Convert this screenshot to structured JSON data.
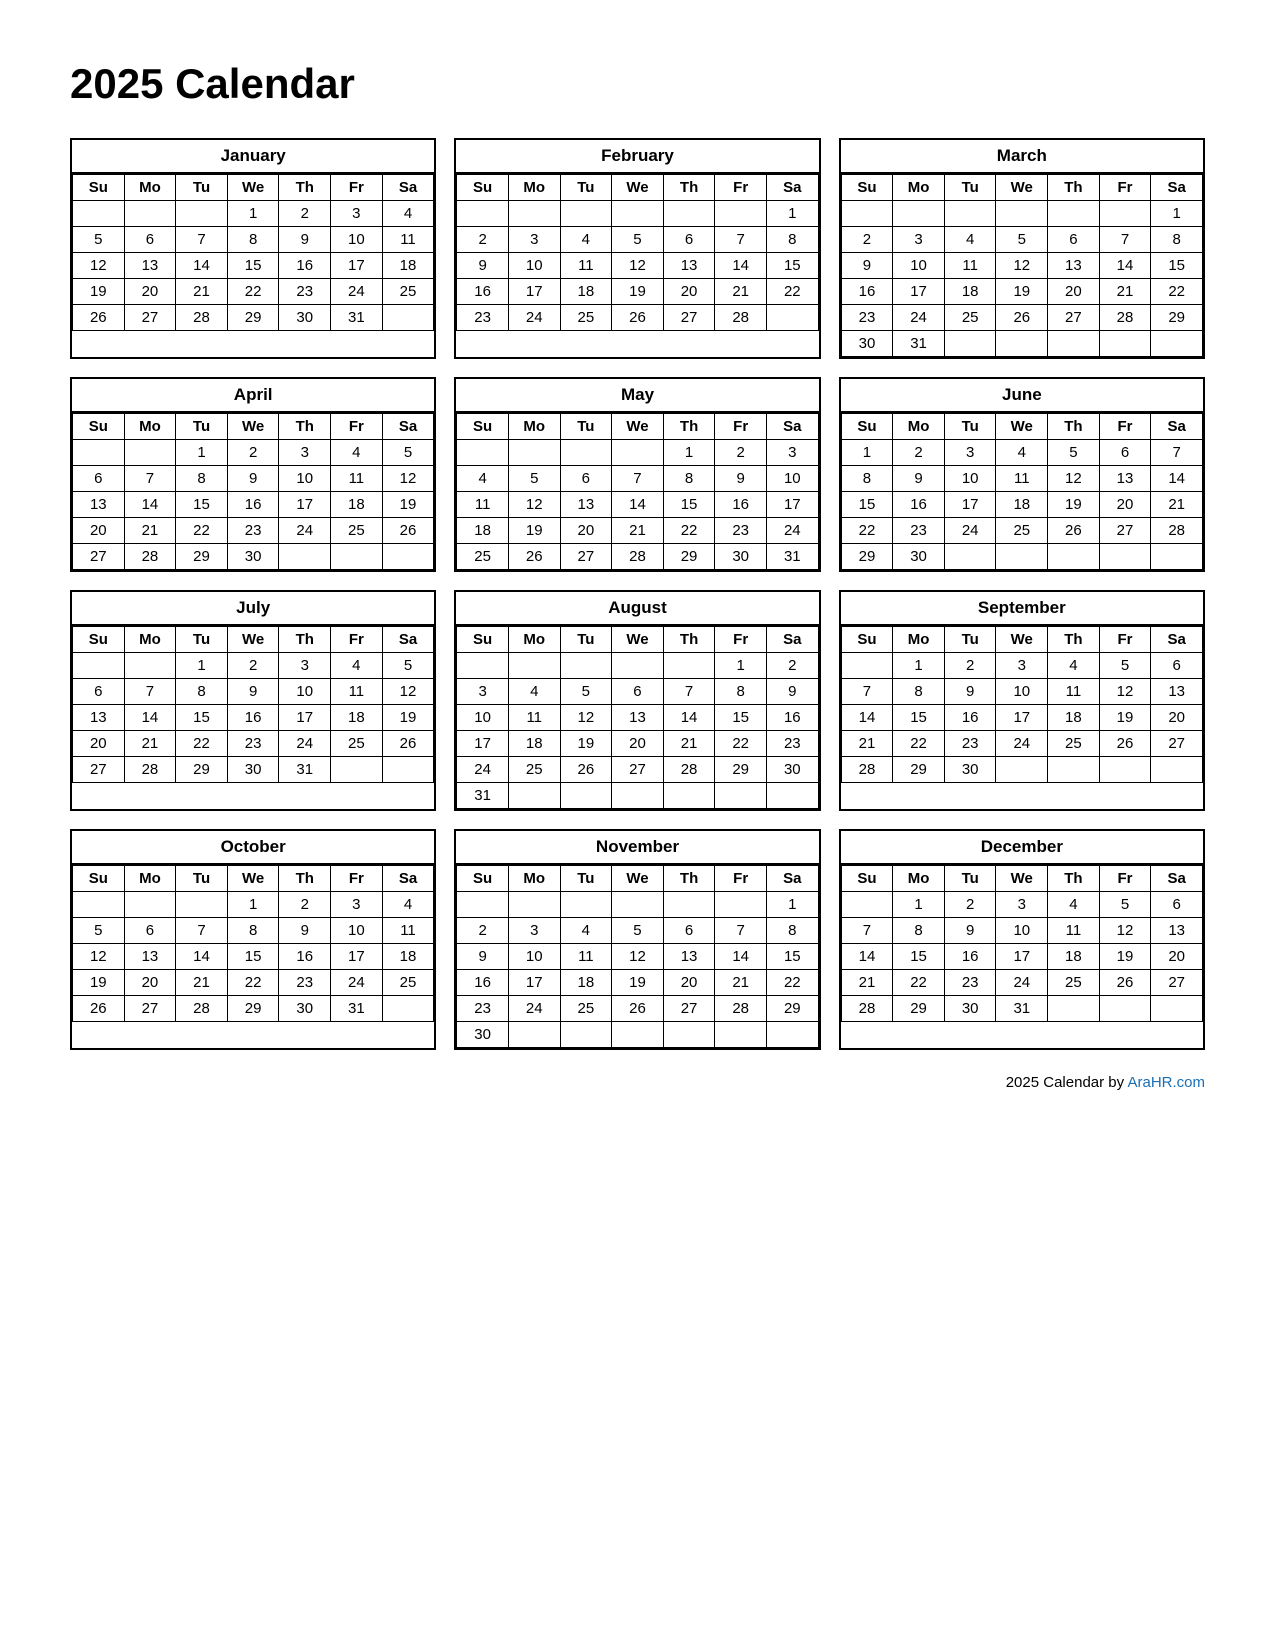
{
  "title": "2025 Calendar",
  "footer": {
    "text": "2025  Calendar by ",
    "link_label": "AraHR.com",
    "link_url": "AraHR.com"
  },
  "months": [
    {
      "name": "January",
      "days_header": [
        "Su",
        "Mo",
        "Tu",
        "We",
        "Th",
        "Fr",
        "Sa"
      ],
      "weeks": [
        [
          "",
          "",
          "",
          "1",
          "2",
          "3",
          "4"
        ],
        [
          "5",
          "6",
          "7",
          "8",
          "9",
          "10",
          "11"
        ],
        [
          "12",
          "13",
          "14",
          "15",
          "16",
          "17",
          "18"
        ],
        [
          "19",
          "20",
          "21",
          "22",
          "23",
          "24",
          "25"
        ],
        [
          "26",
          "27",
          "28",
          "29",
          "30",
          "31",
          ""
        ]
      ]
    },
    {
      "name": "February",
      "days_header": [
        "Su",
        "Mo",
        "Tu",
        "We",
        "Th",
        "Fr",
        "Sa"
      ],
      "weeks": [
        [
          "",
          "",
          "",
          "",
          "",
          "",
          "1"
        ],
        [
          "2",
          "3",
          "4",
          "5",
          "6",
          "7",
          "8"
        ],
        [
          "9",
          "10",
          "11",
          "12",
          "13",
          "14",
          "15"
        ],
        [
          "16",
          "17",
          "18",
          "19",
          "20",
          "21",
          "22"
        ],
        [
          "23",
          "24",
          "25",
          "26",
          "27",
          "28",
          ""
        ]
      ]
    },
    {
      "name": "March",
      "days_header": [
        "Su",
        "Mo",
        "Tu",
        "We",
        "Th",
        "Fr",
        "Sa"
      ],
      "weeks": [
        [
          "",
          "",
          "",
          "",
          "",
          "",
          "1"
        ],
        [
          "2",
          "3",
          "4",
          "5",
          "6",
          "7",
          "8"
        ],
        [
          "9",
          "10",
          "11",
          "12",
          "13",
          "14",
          "15"
        ],
        [
          "16",
          "17",
          "18",
          "19",
          "20",
          "21",
          "22"
        ],
        [
          "23",
          "24",
          "25",
          "26",
          "27",
          "28",
          "29"
        ],
        [
          "30",
          "31",
          "",
          "",
          "",
          "",
          ""
        ]
      ]
    },
    {
      "name": "April",
      "days_header": [
        "Su",
        "Mo",
        "Tu",
        "We",
        "Th",
        "Fr",
        "Sa"
      ],
      "weeks": [
        [
          "",
          "",
          "1",
          "2",
          "3",
          "4",
          "5"
        ],
        [
          "6",
          "7",
          "8",
          "9",
          "10",
          "11",
          "12"
        ],
        [
          "13",
          "14",
          "15",
          "16",
          "17",
          "18",
          "19"
        ],
        [
          "20",
          "21",
          "22",
          "23",
          "24",
          "25",
          "26"
        ],
        [
          "27",
          "28",
          "29",
          "30",
          "",
          "",
          ""
        ]
      ]
    },
    {
      "name": "May",
      "days_header": [
        "Su",
        "Mo",
        "Tu",
        "We",
        "Th",
        "Fr",
        "Sa"
      ],
      "weeks": [
        [
          "",
          "",
          "",
          "",
          "1",
          "2",
          "3"
        ],
        [
          "4",
          "5",
          "6",
          "7",
          "8",
          "9",
          "10"
        ],
        [
          "11",
          "12",
          "13",
          "14",
          "15",
          "16",
          "17"
        ],
        [
          "18",
          "19",
          "20",
          "21",
          "22",
          "23",
          "24"
        ],
        [
          "25",
          "26",
          "27",
          "28",
          "29",
          "30",
          "31"
        ]
      ]
    },
    {
      "name": "June",
      "days_header": [
        "Su",
        "Mo",
        "Tu",
        "We",
        "Th",
        "Fr",
        "Sa"
      ],
      "weeks": [
        [
          "1",
          "2",
          "3",
          "4",
          "5",
          "6",
          "7"
        ],
        [
          "8",
          "9",
          "10",
          "11",
          "12",
          "13",
          "14"
        ],
        [
          "15",
          "16",
          "17",
          "18",
          "19",
          "20",
          "21"
        ],
        [
          "22",
          "23",
          "24",
          "25",
          "26",
          "27",
          "28"
        ],
        [
          "29",
          "30",
          "",
          "",
          "",
          "",
          ""
        ]
      ]
    },
    {
      "name": "July",
      "days_header": [
        "Su",
        "Mo",
        "Tu",
        "We",
        "Th",
        "Fr",
        "Sa"
      ],
      "weeks": [
        [
          "",
          "",
          "1",
          "2",
          "3",
          "4",
          "5"
        ],
        [
          "6",
          "7",
          "8",
          "9",
          "10",
          "11",
          "12"
        ],
        [
          "13",
          "14",
          "15",
          "16",
          "17",
          "18",
          "19"
        ],
        [
          "20",
          "21",
          "22",
          "23",
          "24",
          "25",
          "26"
        ],
        [
          "27",
          "28",
          "29",
          "30",
          "31",
          "",
          ""
        ]
      ]
    },
    {
      "name": "August",
      "days_header": [
        "Su",
        "Mo",
        "Tu",
        "We",
        "Th",
        "Fr",
        "Sa"
      ],
      "weeks": [
        [
          "",
          "",
          "",
          "",
          "",
          "1",
          "2"
        ],
        [
          "3",
          "4",
          "5",
          "6",
          "7",
          "8",
          "9"
        ],
        [
          "10",
          "11",
          "12",
          "13",
          "14",
          "15",
          "16"
        ],
        [
          "17",
          "18",
          "19",
          "20",
          "21",
          "22",
          "23"
        ],
        [
          "24",
          "25",
          "26",
          "27",
          "28",
          "29",
          "30"
        ],
        [
          "31",
          "",
          "",
          "",
          "",
          "",
          ""
        ]
      ]
    },
    {
      "name": "September",
      "days_header": [
        "Su",
        "Mo",
        "Tu",
        "We",
        "Th",
        "Fr",
        "Sa"
      ],
      "weeks": [
        [
          "",
          "1",
          "2",
          "3",
          "4",
          "5",
          "6"
        ],
        [
          "7",
          "8",
          "9",
          "10",
          "11",
          "12",
          "13"
        ],
        [
          "14",
          "15",
          "16",
          "17",
          "18",
          "19",
          "20"
        ],
        [
          "21",
          "22",
          "23",
          "24",
          "25",
          "26",
          "27"
        ],
        [
          "28",
          "29",
          "30",
          "",
          "",
          "",
          ""
        ]
      ]
    },
    {
      "name": "October",
      "days_header": [
        "Su",
        "Mo",
        "Tu",
        "We",
        "Th",
        "Fr",
        "Sa"
      ],
      "weeks": [
        [
          "",
          "",
          "",
          "1",
          "2",
          "3",
          "4"
        ],
        [
          "5",
          "6",
          "7",
          "8",
          "9",
          "10",
          "11"
        ],
        [
          "12",
          "13",
          "14",
          "15",
          "16",
          "17",
          "18"
        ],
        [
          "19",
          "20",
          "21",
          "22",
          "23",
          "24",
          "25"
        ],
        [
          "26",
          "27",
          "28",
          "29",
          "30",
          "31",
          ""
        ]
      ]
    },
    {
      "name": "November",
      "days_header": [
        "Su",
        "Mo",
        "Tu",
        "We",
        "Th",
        "Fr",
        "Sa"
      ],
      "weeks": [
        [
          "",
          "",
          "",
          "",
          "",
          "",
          "1"
        ],
        [
          "2",
          "3",
          "4",
          "5",
          "6",
          "7",
          "8"
        ],
        [
          "9",
          "10",
          "11",
          "12",
          "13",
          "14",
          "15"
        ],
        [
          "16",
          "17",
          "18",
          "19",
          "20",
          "21",
          "22"
        ],
        [
          "23",
          "24",
          "25",
          "26",
          "27",
          "28",
          "29"
        ],
        [
          "30",
          "",
          "",
          "",
          "",
          "",
          ""
        ]
      ]
    },
    {
      "name": "December",
      "days_header": [
        "Su",
        "Mo",
        "Tu",
        "We",
        "Th",
        "Fr",
        "Sa"
      ],
      "weeks": [
        [
          "",
          "1",
          "2",
          "3",
          "4",
          "5",
          "6"
        ],
        [
          "7",
          "8",
          "9",
          "10",
          "11",
          "12",
          "13"
        ],
        [
          "14",
          "15",
          "16",
          "17",
          "18",
          "19",
          "20"
        ],
        [
          "21",
          "22",
          "23",
          "24",
          "25",
          "26",
          "27"
        ],
        [
          "28",
          "29",
          "30",
          "31",
          "",
          "",
          ""
        ]
      ]
    }
  ]
}
